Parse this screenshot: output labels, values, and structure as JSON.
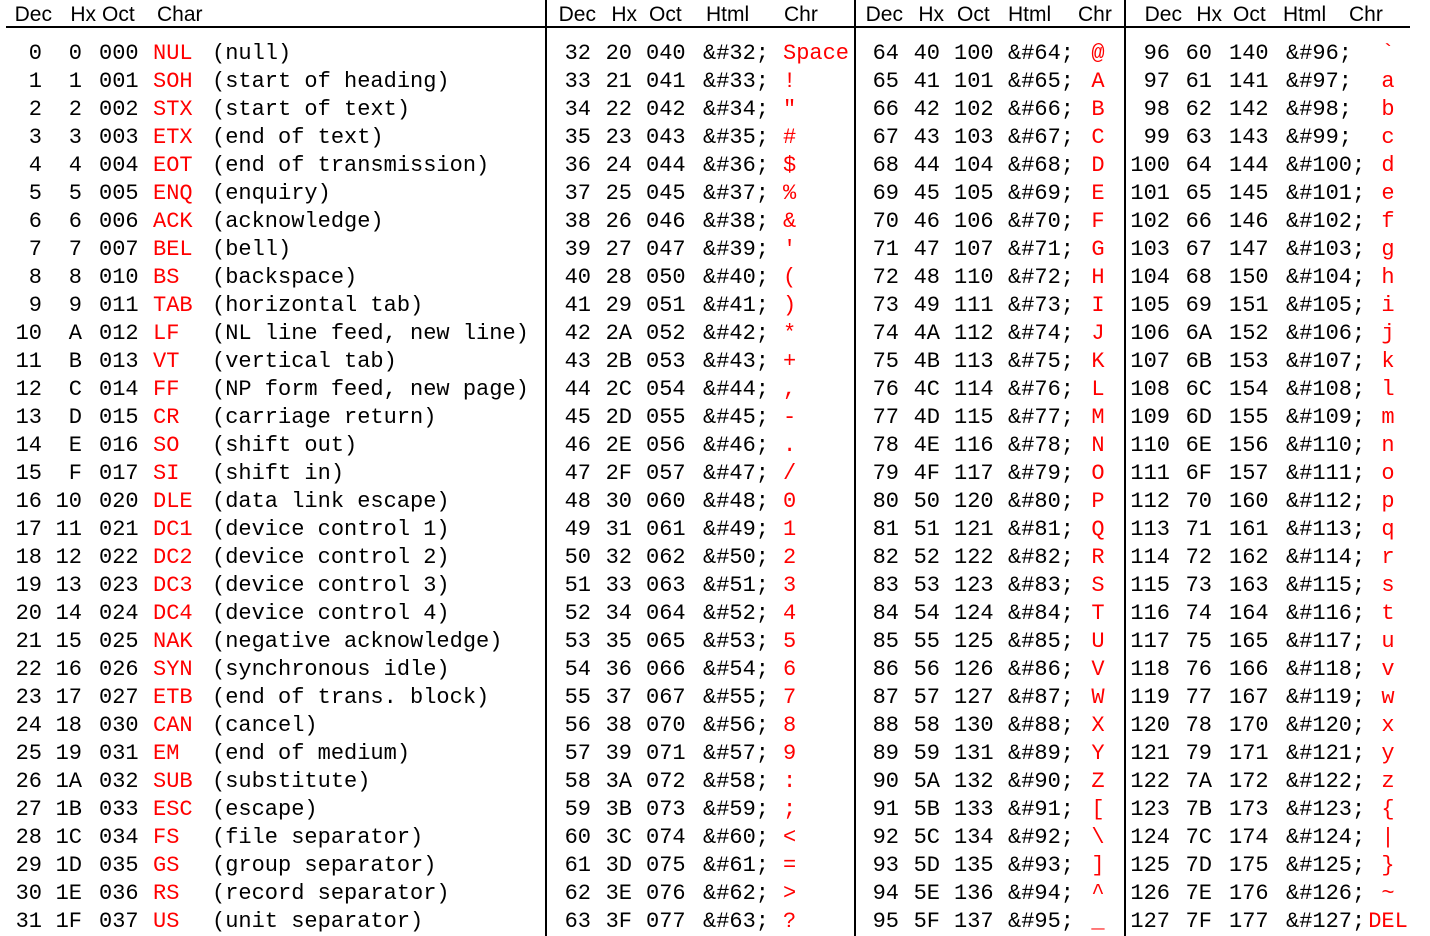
{
  "headers": {
    "block0": [
      "Dec",
      "Hx",
      "Oct",
      "Char"
    ],
    "block1": [
      "Dec",
      "Hx",
      "Oct",
      "Html",
      "Chr"
    ],
    "block2": [
      "Dec",
      "Hx",
      "Oct",
      "Html",
      "Chr"
    ],
    "block3": [
      "Dec",
      "Hx",
      "Oct",
      "Html",
      "Chr"
    ]
  },
  "block0_rows": [
    [
      "0",
      "0",
      "000",
      "NUL",
      "(null)"
    ],
    [
      "1",
      "1",
      "001",
      "SOH",
      "(start of heading)"
    ],
    [
      "2",
      "2",
      "002",
      "STX",
      "(start of text)"
    ],
    [
      "3",
      "3",
      "003",
      "ETX",
      "(end of text)"
    ],
    [
      "4",
      "4",
      "004",
      "EOT",
      "(end of transmission)"
    ],
    [
      "5",
      "5",
      "005",
      "ENQ",
      "(enquiry)"
    ],
    [
      "6",
      "6",
      "006",
      "ACK",
      "(acknowledge)"
    ],
    [
      "7",
      "7",
      "007",
      "BEL",
      "(bell)"
    ],
    [
      "8",
      "8",
      "010",
      "BS",
      "(backspace)"
    ],
    [
      "9",
      "9",
      "011",
      "TAB",
      "(horizontal tab)"
    ],
    [
      "10",
      "A",
      "012",
      "LF",
      "(NL line feed, new line)"
    ],
    [
      "11",
      "B",
      "013",
      "VT",
      "(vertical tab)"
    ],
    [
      "12",
      "C",
      "014",
      "FF",
      "(NP form feed, new page)"
    ],
    [
      "13",
      "D",
      "015",
      "CR",
      "(carriage return)"
    ],
    [
      "14",
      "E",
      "016",
      "SO",
      "(shift out)"
    ],
    [
      "15",
      "F",
      "017",
      "SI",
      "(shift in)"
    ],
    [
      "16",
      "10",
      "020",
      "DLE",
      "(data link escape)"
    ],
    [
      "17",
      "11",
      "021",
      "DC1",
      "(device control 1)"
    ],
    [
      "18",
      "12",
      "022",
      "DC2",
      "(device control 2)"
    ],
    [
      "19",
      "13",
      "023",
      "DC3",
      "(device control 3)"
    ],
    [
      "20",
      "14",
      "024",
      "DC4",
      "(device control 4)"
    ],
    [
      "21",
      "15",
      "025",
      "NAK",
      "(negative acknowledge)"
    ],
    [
      "22",
      "16",
      "026",
      "SYN",
      "(synchronous idle)"
    ],
    [
      "23",
      "17",
      "027",
      "ETB",
      "(end of trans. block)"
    ],
    [
      "24",
      "18",
      "030",
      "CAN",
      "(cancel)"
    ],
    [
      "25",
      "19",
      "031",
      "EM",
      "(end of medium)"
    ],
    [
      "26",
      "1A",
      "032",
      "SUB",
      "(substitute)"
    ],
    [
      "27",
      "1B",
      "033",
      "ESC",
      "(escape)"
    ],
    [
      "28",
      "1C",
      "034",
      "FS",
      "(file separator)"
    ],
    [
      "29",
      "1D",
      "035",
      "GS",
      "(group separator)"
    ],
    [
      "30",
      "1E",
      "036",
      "RS",
      "(record separator)"
    ],
    [
      "31",
      "1F",
      "037",
      "US",
      "(unit separator)"
    ]
  ],
  "block1_rows": [
    [
      "32",
      "20",
      "040",
      "&#32;",
      "Space"
    ],
    [
      "33",
      "21",
      "041",
      "&#33;",
      "!"
    ],
    [
      "34",
      "22",
      "042",
      "&#34;",
      "\""
    ],
    [
      "35",
      "23",
      "043",
      "&#35;",
      "#"
    ],
    [
      "36",
      "24",
      "044",
      "&#36;",
      "$"
    ],
    [
      "37",
      "25",
      "045",
      "&#37;",
      "%"
    ],
    [
      "38",
      "26",
      "046",
      "&#38;",
      "&"
    ],
    [
      "39",
      "27",
      "047",
      "&#39;",
      "'"
    ],
    [
      "40",
      "28",
      "050",
      "&#40;",
      "("
    ],
    [
      "41",
      "29",
      "051",
      "&#41;",
      ")"
    ],
    [
      "42",
      "2A",
      "052",
      "&#42;",
      "*"
    ],
    [
      "43",
      "2B",
      "053",
      "&#43;",
      "+"
    ],
    [
      "44",
      "2C",
      "054",
      "&#44;",
      ","
    ],
    [
      "45",
      "2D",
      "055",
      "&#45;",
      "-"
    ],
    [
      "46",
      "2E",
      "056",
      "&#46;",
      "."
    ],
    [
      "47",
      "2F",
      "057",
      "&#47;",
      "/"
    ],
    [
      "48",
      "30",
      "060",
      "&#48;",
      "0"
    ],
    [
      "49",
      "31",
      "061",
      "&#49;",
      "1"
    ],
    [
      "50",
      "32",
      "062",
      "&#50;",
      "2"
    ],
    [
      "51",
      "33",
      "063",
      "&#51;",
      "3"
    ],
    [
      "52",
      "34",
      "064",
      "&#52;",
      "4"
    ],
    [
      "53",
      "35",
      "065",
      "&#53;",
      "5"
    ],
    [
      "54",
      "36",
      "066",
      "&#54;",
      "6"
    ],
    [
      "55",
      "37",
      "067",
      "&#55;",
      "7"
    ],
    [
      "56",
      "38",
      "070",
      "&#56;",
      "8"
    ],
    [
      "57",
      "39",
      "071",
      "&#57;",
      "9"
    ],
    [
      "58",
      "3A",
      "072",
      "&#58;",
      ":"
    ],
    [
      "59",
      "3B",
      "073",
      "&#59;",
      ";"
    ],
    [
      "60",
      "3C",
      "074",
      "&#60;",
      "<"
    ],
    [
      "61",
      "3D",
      "075",
      "&#61;",
      "="
    ],
    [
      "62",
      "3E",
      "076",
      "&#62;",
      ">"
    ],
    [
      "63",
      "3F",
      "077",
      "&#63;",
      "?"
    ]
  ],
  "block2_rows": [
    [
      "64",
      "40",
      "100",
      "&#64;",
      "@"
    ],
    [
      "65",
      "41",
      "101",
      "&#65;",
      "A"
    ],
    [
      "66",
      "42",
      "102",
      "&#66;",
      "B"
    ],
    [
      "67",
      "43",
      "103",
      "&#67;",
      "C"
    ],
    [
      "68",
      "44",
      "104",
      "&#68;",
      "D"
    ],
    [
      "69",
      "45",
      "105",
      "&#69;",
      "E"
    ],
    [
      "70",
      "46",
      "106",
      "&#70;",
      "F"
    ],
    [
      "71",
      "47",
      "107",
      "&#71;",
      "G"
    ],
    [
      "72",
      "48",
      "110",
      "&#72;",
      "H"
    ],
    [
      "73",
      "49",
      "111",
      "&#73;",
      "I"
    ],
    [
      "74",
      "4A",
      "112",
      "&#74;",
      "J"
    ],
    [
      "75",
      "4B",
      "113",
      "&#75;",
      "K"
    ],
    [
      "76",
      "4C",
      "114",
      "&#76;",
      "L"
    ],
    [
      "77",
      "4D",
      "115",
      "&#77;",
      "M"
    ],
    [
      "78",
      "4E",
      "116",
      "&#78;",
      "N"
    ],
    [
      "79",
      "4F",
      "117",
      "&#79;",
      "O"
    ],
    [
      "80",
      "50",
      "120",
      "&#80;",
      "P"
    ],
    [
      "81",
      "51",
      "121",
      "&#81;",
      "Q"
    ],
    [
      "82",
      "52",
      "122",
      "&#82;",
      "R"
    ],
    [
      "83",
      "53",
      "123",
      "&#83;",
      "S"
    ],
    [
      "84",
      "54",
      "124",
      "&#84;",
      "T"
    ],
    [
      "85",
      "55",
      "125",
      "&#85;",
      "U"
    ],
    [
      "86",
      "56",
      "126",
      "&#86;",
      "V"
    ],
    [
      "87",
      "57",
      "127",
      "&#87;",
      "W"
    ],
    [
      "88",
      "58",
      "130",
      "&#88;",
      "X"
    ],
    [
      "89",
      "59",
      "131",
      "&#89;",
      "Y"
    ],
    [
      "90",
      "5A",
      "132",
      "&#90;",
      "Z"
    ],
    [
      "91",
      "5B",
      "133",
      "&#91;",
      "["
    ],
    [
      "92",
      "5C",
      "134",
      "&#92;",
      "\\"
    ],
    [
      "93",
      "5D",
      "135",
      "&#93;",
      "]"
    ],
    [
      "94",
      "5E",
      "136",
      "&#94;",
      "^"
    ],
    [
      "95",
      "5F",
      "137",
      "&#95;",
      "_"
    ]
  ],
  "block3_rows": [
    [
      "96",
      "60",
      "140",
      "&#96;",
      "`"
    ],
    [
      "97",
      "61",
      "141",
      "&#97;",
      "a"
    ],
    [
      "98",
      "62",
      "142",
      "&#98;",
      "b"
    ],
    [
      "99",
      "63",
      "143",
      "&#99;",
      "c"
    ],
    [
      "100",
      "64",
      "144",
      "&#100;",
      "d"
    ],
    [
      "101",
      "65",
      "145",
      "&#101;",
      "e"
    ],
    [
      "102",
      "66",
      "146",
      "&#102;",
      "f"
    ],
    [
      "103",
      "67",
      "147",
      "&#103;",
      "g"
    ],
    [
      "104",
      "68",
      "150",
      "&#104;",
      "h"
    ],
    [
      "105",
      "69",
      "151",
      "&#105;",
      "i"
    ],
    [
      "106",
      "6A",
      "152",
      "&#106;",
      "j"
    ],
    [
      "107",
      "6B",
      "153",
      "&#107;",
      "k"
    ],
    [
      "108",
      "6C",
      "154",
      "&#108;",
      "l"
    ],
    [
      "109",
      "6D",
      "155",
      "&#109;",
      "m"
    ],
    [
      "110",
      "6E",
      "156",
      "&#110;",
      "n"
    ],
    [
      "111",
      "6F",
      "157",
      "&#111;",
      "o"
    ],
    [
      "112",
      "70",
      "160",
      "&#112;",
      "p"
    ],
    [
      "113",
      "71",
      "161",
      "&#113;",
      "q"
    ],
    [
      "114",
      "72",
      "162",
      "&#114;",
      "r"
    ],
    [
      "115",
      "73",
      "163",
      "&#115;",
      "s"
    ],
    [
      "116",
      "74",
      "164",
      "&#116;",
      "t"
    ],
    [
      "117",
      "75",
      "165",
      "&#117;",
      "u"
    ],
    [
      "118",
      "76",
      "166",
      "&#118;",
      "v"
    ],
    [
      "119",
      "77",
      "167",
      "&#119;",
      "w"
    ],
    [
      "120",
      "78",
      "170",
      "&#120;",
      "x"
    ],
    [
      "121",
      "79",
      "171",
      "&#121;",
      "y"
    ],
    [
      "122",
      "7A",
      "172",
      "&#122;",
      "z"
    ],
    [
      "123",
      "7B",
      "173",
      "&#123;",
      "{"
    ],
    [
      "124",
      "7C",
      "174",
      "&#124;",
      "|"
    ],
    [
      "125",
      "7D",
      "175",
      "&#125;",
      "}"
    ],
    [
      "126",
      "7E",
      "176",
      "&#126;",
      "~"
    ],
    [
      "127",
      "7F",
      "177",
      "&#127;",
      "DEL"
    ]
  ],
  "colors": {
    "text": "#000000",
    "accent": "#ff0000",
    "background": "#ffffff"
  }
}
